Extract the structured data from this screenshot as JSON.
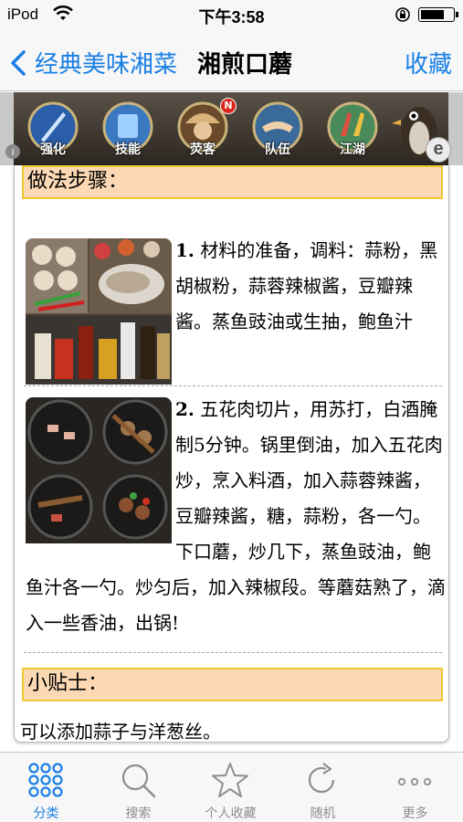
{
  "status_bar": {
    "carrier": "iPod",
    "time": "下午3:58",
    "icons": [
      "wifi-icon",
      "orientation-lock-icon",
      "battery-icon"
    ]
  },
  "nav": {
    "back_label": "经典美味湘菜",
    "title": "湘煎口蘑",
    "favorite_label": "收藏"
  },
  "banner": {
    "items": [
      {
        "label": "强化",
        "icon": "sword-icon"
      },
      {
        "label": "技能",
        "icon": "skill-icon"
      },
      {
        "label": "荧客",
        "icon": "hero-icon",
        "badge": "N"
      },
      {
        "label": "队伍",
        "icon": "team-icon"
      },
      {
        "label": "江湖",
        "icon": "world-icon"
      }
    ],
    "info_glyph": "i",
    "e_glyph": "e"
  },
  "content": {
    "steps_header": "做法步骤：",
    "steps": [
      {
        "number": "1.",
        "text": "材料的准备，调料：蒜粉，黑胡椒粉，蒜蓉辣椒酱，豆瓣辣酱。蒸鱼豉油或生抽，鲍鱼汁"
      },
      {
        "number": "2.",
        "text": "五花肉切片，用苏打，白酒腌制5分钟。锅里倒油，加入五花肉炒，烹入料酒，加入蒜蓉辣酱，豆瓣辣酱，糖，蒜粉，各一勺。下口蘑，炒几下，蒸鱼豉油，鲍鱼汁各一勺。炒匀后，加入辣椒段。等蘑菇熟了，滴入一些香油，出锅!"
      }
    ],
    "tips_header": "小贴士：",
    "tips_text": "可以添加蒜子与洋葱丝。"
  },
  "tabbar": {
    "tabs": [
      {
        "label": "分类",
        "icon": "grid-icon",
        "active": true
      },
      {
        "label": "搜索",
        "icon": "search-icon",
        "active": false
      },
      {
        "label": "个人收藏",
        "icon": "star-icon",
        "active": false
      },
      {
        "label": "随机",
        "icon": "refresh-icon",
        "active": false
      },
      {
        "label": "更多",
        "icon": "more-icon",
        "active": false
      }
    ]
  },
  "colors": {
    "accent": "#1a7fe5",
    "section_bg": "#fcd9b4",
    "section_border": "#f0c830"
  }
}
